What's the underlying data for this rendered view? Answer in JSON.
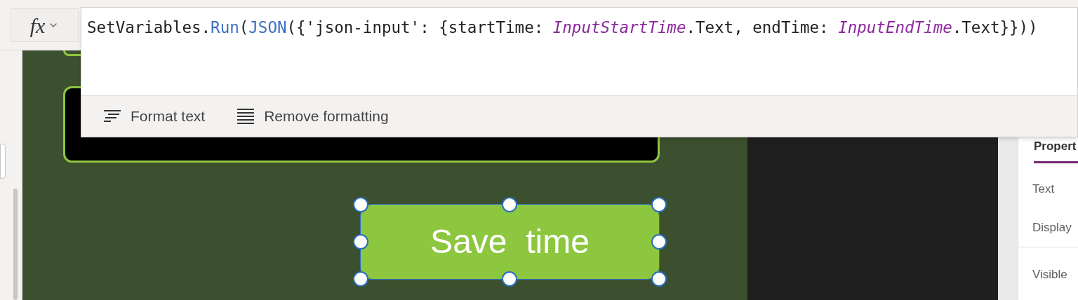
{
  "formula_bar": {
    "function_button": {
      "label": "fx"
    },
    "tokens": [
      {
        "text": "SetVariables.",
        "kind": "plain"
      },
      {
        "text": "Run",
        "kind": "function"
      },
      {
        "text": "(",
        "kind": "plain"
      },
      {
        "text": "JSON",
        "kind": "function"
      },
      {
        "text": "({'json-input': {startTime: ",
        "kind": "plain"
      },
      {
        "text": "InputStartTime",
        "kind": "control"
      },
      {
        "text": ".Text, endTime: ",
        "kind": "plain"
      },
      {
        "text": "InputEndTime",
        "kind": "control"
      },
      {
        "text": ".Text}}))",
        "kind": "plain"
      }
    ]
  },
  "format_toolbar": {
    "buttons": [
      {
        "label": "Format text",
        "kind": "format"
      },
      {
        "label": "Remove formatting",
        "kind": "remove"
      }
    ]
  },
  "canvas": {
    "button": {
      "label": "Save  time",
      "selected": true
    }
  },
  "properties_panel": {
    "tab": {
      "label": "Propert",
      "selected": true
    },
    "groups": [
      {
        "items": [
          "Text",
          "Display"
        ]
      },
      {
        "items": [
          "Visible"
        ]
      }
    ]
  }
}
